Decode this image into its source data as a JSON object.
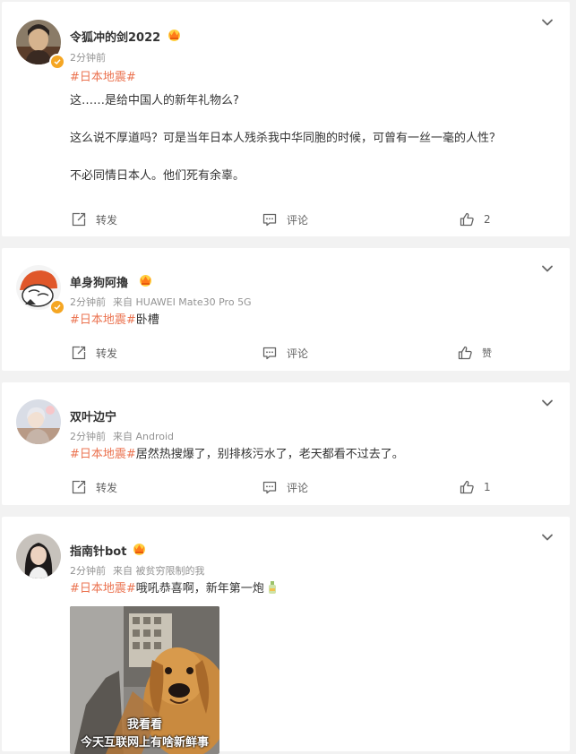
{
  "posts": [
    {
      "user": "令狐冲的剑2022",
      "time": "2分钟前",
      "source": "",
      "tag": "#日本地震#",
      "lines": [
        "这……是给中国人的新年礼物么?",
        "这么说不厚道吗？可是当年日本人残杀我中华同胞的时候，可曾有一丝一毫的人性？",
        "不必同情日本人。他们死有余辜。"
      ],
      "repost_label": "转发",
      "comment_label": "评论",
      "like_label": "2"
    },
    {
      "user": "单身狗阿擼",
      "time": "2分钟前",
      "source": "来自 HUAWEI Mate30 Pro 5G",
      "tag": "#日本地震#",
      "text": "卧槽",
      "repost_label": "转发",
      "comment_label": "评论",
      "like_label": "赞"
    },
    {
      "user": "双叶边宁",
      "time": "2分钟前",
      "source": "来自 Android",
      "tag": "#日本地震#",
      "text": "居然热搜爆了，别排核污水了，老天都看不过去了。",
      "repost_label": "转发",
      "comment_label": "评论",
      "like_label": "1"
    },
    {
      "user": "指南针bot",
      "time": "2分钟前",
      "source": "来自 被贫穷限制的我",
      "tag": "#日本地震#",
      "text": "哦吼恭喜啊，新年第一炮",
      "image_caption_1": "我看看",
      "image_caption_2": "今天互联网上有啥新鲜事"
    }
  ],
  "colors": {
    "accent": "#eb7350",
    "badge": "#f5a623",
    "muted": "#939393"
  },
  "icons": [
    "chevron-down-icon",
    "crown-icon",
    "verified-icon",
    "repost-icon",
    "comment-icon",
    "like-icon",
    "bottle-emoji-icon"
  ]
}
